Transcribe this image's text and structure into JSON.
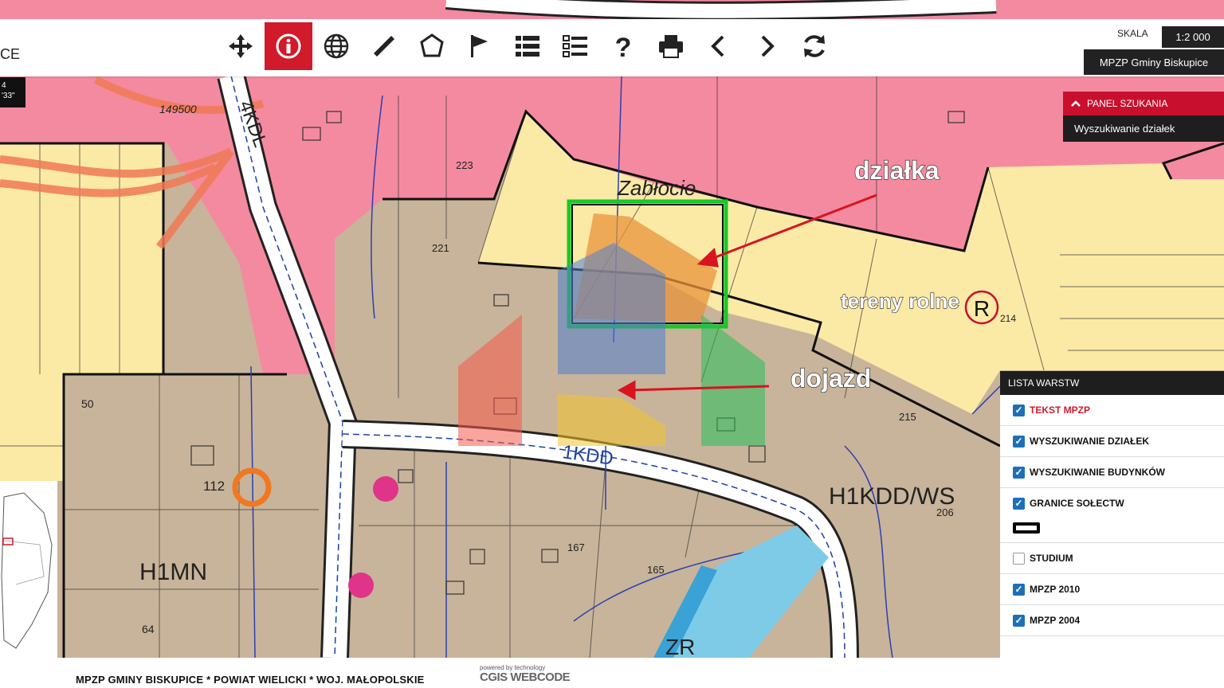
{
  "app": {
    "title_fragment": "CE"
  },
  "toolbar": {
    "tools": [
      {
        "name": "pan",
        "icon": "move-icon"
      },
      {
        "name": "info",
        "icon": "info-icon",
        "active": true
      },
      {
        "name": "globe",
        "icon": "globe-icon"
      },
      {
        "name": "measure-distance",
        "icon": "ruler-icon"
      },
      {
        "name": "measure-area",
        "icon": "polygon-icon"
      },
      {
        "name": "flag",
        "icon": "flag-icon"
      },
      {
        "name": "legend",
        "icon": "list-icon"
      },
      {
        "name": "layers-list",
        "icon": "checklist-icon"
      },
      {
        "name": "help",
        "icon": "help-icon"
      },
      {
        "name": "print",
        "icon": "print-icon"
      },
      {
        "name": "back",
        "icon": "chevron-left-icon"
      },
      {
        "name": "forward",
        "icon": "chevron-right-icon"
      },
      {
        "name": "refresh",
        "icon": "refresh-icon"
      }
    ]
  },
  "scale": {
    "label": "SKALA",
    "value": "1:2 000"
  },
  "project": {
    "name": "MPZP Gminy Biskupice"
  },
  "coords": {
    "line1": "4",
    "line2": "'33\""
  },
  "search_panel": {
    "header": "PANEL SZUKANIA",
    "item": "Wyszukiwanie działek"
  },
  "layers": {
    "header": "LISTA WARSTW",
    "items": [
      {
        "label": "TEKST MPZP",
        "checked": true,
        "color": "#d11a2a"
      },
      {
        "label": "WYSZUKIWANIE DZIAŁEK",
        "checked": true
      },
      {
        "label": "WYSZUKIWANIE BUDYNKÓW",
        "checked": true
      },
      {
        "label": "GRANICE SOŁECTW",
        "checked": true
      },
      {
        "label": "STUDIUM",
        "checked": false
      },
      {
        "label": "MPZP 2010",
        "checked": true
      },
      {
        "label": "MPZP 2004",
        "checked": true
      }
    ]
  },
  "map_labels": {
    "zablocie": "Zabłocie",
    "dzialka": "działka",
    "tereny_rolne": "tereny rolne",
    "dojazd": "dojazd",
    "r_symbol": "R",
    "h1mn": "H1MN",
    "h1kdd": "H1KDD/WS",
    "zr": "ZR",
    "kdl": "4KDL",
    "kdd": "1KDD",
    "plot_112": "112",
    "n214": "214",
    "n221": "221",
    "n223": "223",
    "n167": "167",
    "n165": "165",
    "n215": "215",
    "n206": "206",
    "n64": "64",
    "n50": "50",
    "n149500": "149500"
  },
  "footer": {
    "text": "MPZP GMINY BISKUPICE * POWIAT WIELICKI * WOJ. MAŁOPOLSKIE",
    "powered": "powered by technology",
    "logo": "CGIS WEBCODE"
  },
  "colors": {
    "pink_zone": "#f48aa0",
    "yellow_zone": "#fbe9a6",
    "brown_zone": "#c8b49a",
    "road": "#ffffff",
    "selection": "#19c829",
    "accent_red": "#c8102e"
  }
}
